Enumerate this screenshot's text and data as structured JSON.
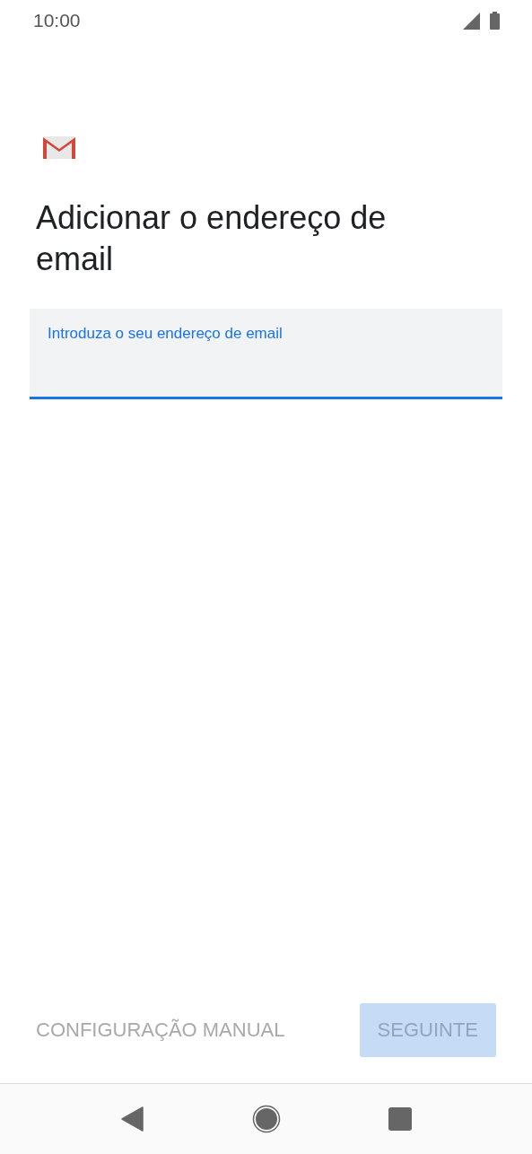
{
  "status_bar": {
    "time": "10:00"
  },
  "title": "Adicionar o endereço de email",
  "email_field": {
    "placeholder": "Introduza o seu endereço de email",
    "focused": true
  },
  "buttons": [
    {
      "label": "CONFIGURAÇÃO MANUAL",
      "kind": "text",
      "disabled": true
    },
    {
      "label": "SEGUINTE",
      "kind": "filled",
      "disabled": true
    }
  ]
}
